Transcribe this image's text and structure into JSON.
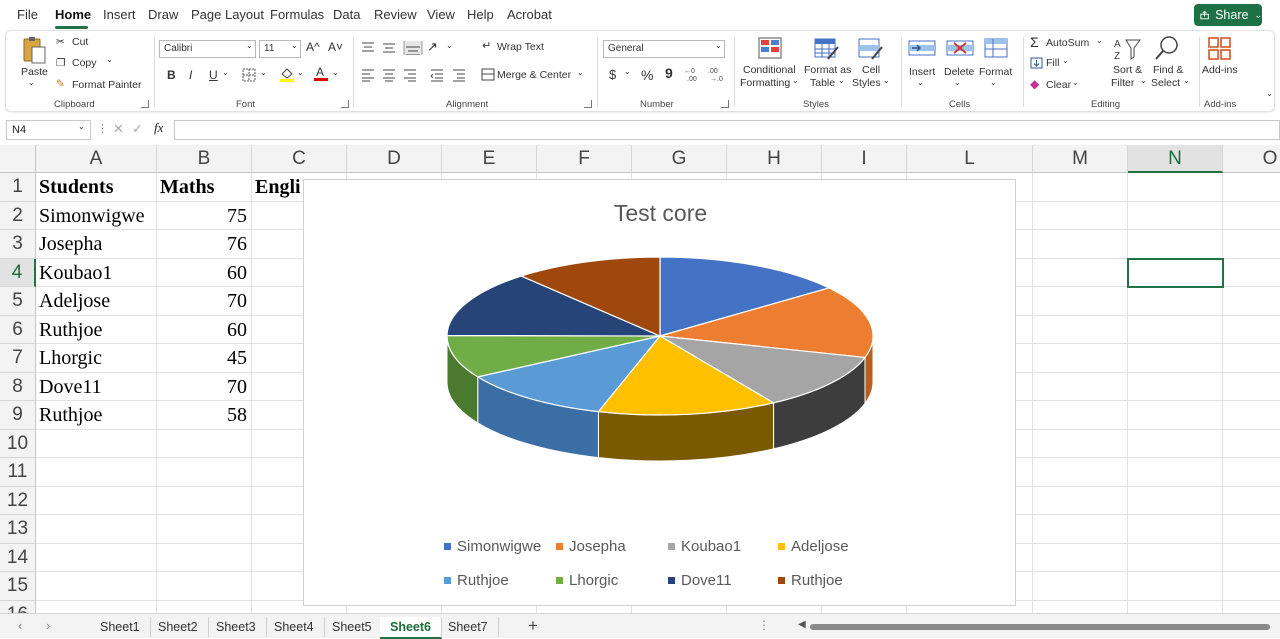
{
  "menu": {
    "items": [
      "File",
      "Home",
      "Insert",
      "Draw",
      "Page Layout",
      "Formulas",
      "Data",
      "Review",
      "View",
      "Help",
      "Acrobat"
    ],
    "share_label": "Share"
  },
  "ribbon": {
    "clipboard": {
      "paste": "Paste",
      "cut": "Cut",
      "copy": "Copy",
      "format_painter": "Format Painter",
      "label": "Clipboard"
    },
    "font": {
      "name": "Calibri",
      "size": "11",
      "grow": "A^",
      "shrink": "A˅",
      "bold": "B",
      "italic": "I",
      "underline": "U",
      "label": "Font"
    },
    "alignment": {
      "wrap": "Wrap Text",
      "merge": "Merge & Center",
      "label": "Alignment"
    },
    "number": {
      "format": "General",
      "currency": "$",
      "percent": "%",
      "comma": "9",
      "label": "Number"
    },
    "styles": {
      "conditional1": "Conditional",
      "conditional2": "Formatting",
      "table1": "Format as",
      "table2": "Table",
      "cell1": "Cell",
      "cell2": "Styles",
      "label": "Styles"
    },
    "cells": {
      "insert": "Insert",
      "delete": "Delete",
      "format": "Format",
      "label": "Cells"
    },
    "editing": {
      "autosum": "AutoSum",
      "fill": "Fill",
      "clear": "Clear",
      "sort1": "Sort &",
      "sort2": "Filter",
      "find1": "Find &",
      "find2": "Select",
      "label": "Editing"
    },
    "addins": {
      "addins": "Add-ins",
      "label": "Add-ins"
    }
  },
  "formula_bar": {
    "name_box": "N4",
    "fx": "fx",
    "value": ""
  },
  "grid": {
    "columns": [
      "A",
      "B",
      "C",
      "D",
      "E",
      "F",
      "G",
      "H",
      "I",
      "L",
      "M",
      "N",
      "O"
    ],
    "rows": [
      "1",
      "2",
      "3",
      "4",
      "5",
      "6",
      "7",
      "8",
      "9",
      "10",
      "11",
      "12",
      "13",
      "14",
      "15",
      "16"
    ],
    "selected_column": "N",
    "selected_row": "4",
    "header": [
      "Students",
      "Maths",
      "Engli"
    ],
    "data": [
      {
        "student": "Simonwigwe",
        "maths": "75"
      },
      {
        "student": "Josepha",
        "maths": "76"
      },
      {
        "student": "Koubao1",
        "maths": "60"
      },
      {
        "student": "Adeljose",
        "maths": "70"
      },
      {
        "student": "Ruthjoe",
        "maths": "60"
      },
      {
        "student": "Lhorgic",
        "maths": "45"
      },
      {
        "student": "Dove11",
        "maths": "70"
      },
      {
        "student": "Ruthjoe",
        "maths": "58"
      }
    ]
  },
  "chart_data": {
    "type": "pie",
    "title": "Test  core",
    "categories": [
      "Simonwigwe",
      "Josepha",
      "Koubao1",
      "Adeljose",
      "Ruthjoe",
      "Lhorgic",
      "Dove11",
      "Ruthjoe"
    ],
    "values": [
      75,
      76,
      60,
      70,
      60,
      45,
      70,
      58
    ],
    "colors": [
      "#4472c4",
      "#ed7d31",
      "#a5a5a5",
      "#ffc000",
      "#5b9bd5",
      "#70ad47",
      "#264478",
      "#9e480e"
    ],
    "side_colors": [
      "#2f5597",
      "#b85f1f",
      "#3d3d3d",
      "#7a5a00",
      "#3a6ea5",
      "#4a7a2d",
      "#1a2f54",
      "#6b300a"
    ],
    "legend_position": "bottom",
    "style": "3d"
  },
  "sheets": {
    "tabs": [
      "Sheet1",
      "Sheet2",
      "Sheet3",
      "Sheet4",
      "Sheet5",
      "Sheet6",
      "Sheet7"
    ],
    "active": "Sheet6",
    "add": "+"
  }
}
